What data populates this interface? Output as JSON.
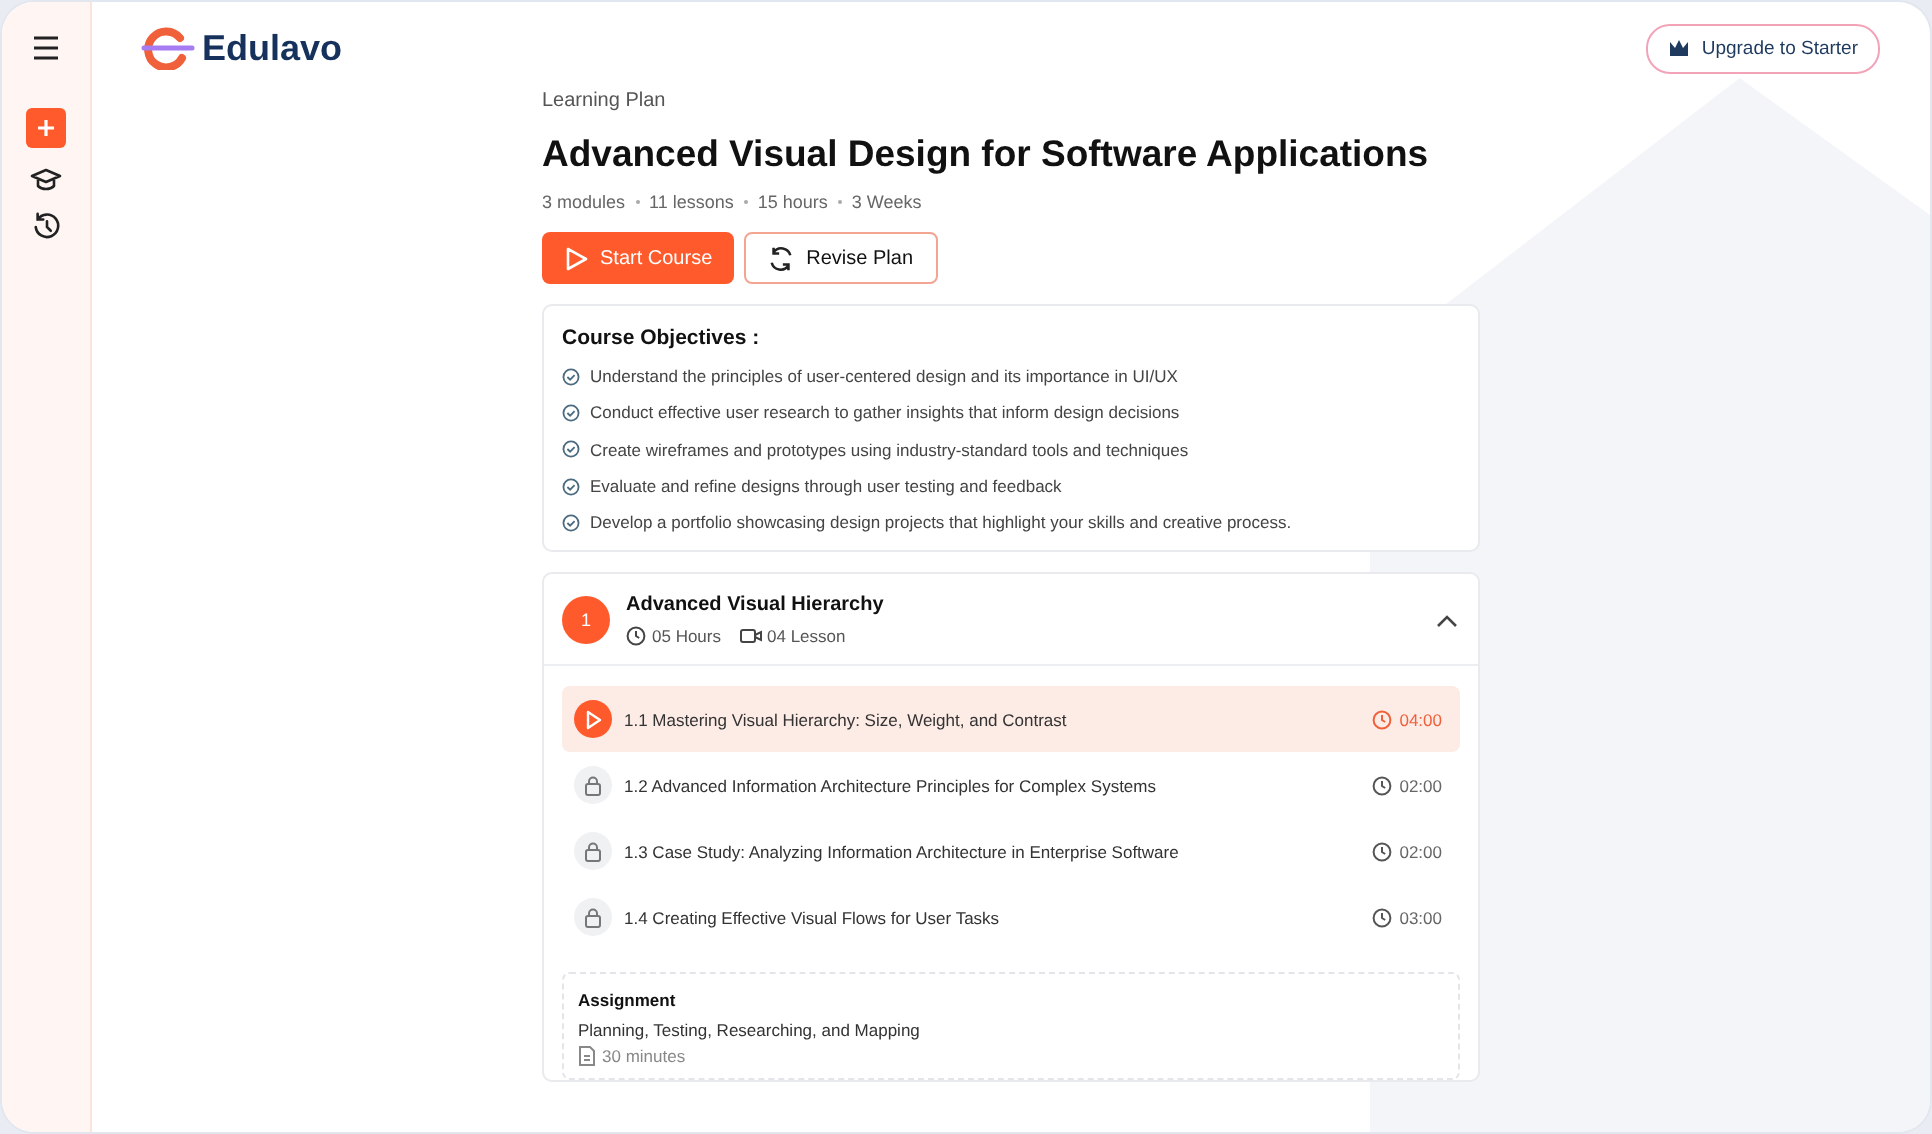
{
  "brand": {
    "name": "Edulavo"
  },
  "upgrade_button": {
    "label": "Upgrade to Starter"
  },
  "eyebrow": "Learning Plan",
  "title": "Advanced Visual Design for Software Applications",
  "meta": [
    "3 modules",
    "11 lessons",
    "15 hours",
    "3 Weeks"
  ],
  "actions": [
    {
      "label": "Start Course",
      "kind": "primary"
    },
    {
      "label": "Revise Plan",
      "kind": "secondary"
    }
  ],
  "objectives": {
    "heading": "Course Objectives :",
    "items": [
      "Understand the principles of user-centered design and its importance in UI/UX",
      "Conduct effective user research to gather insights that inform design decisions",
      "Create wireframes and prototypes using industry-standard tools and techniques",
      "Evaluate and refine designs through user testing and feedback",
      "Develop a portfolio showcasing design projects that highlight your skills and creative process."
    ]
  },
  "module": {
    "number": "1",
    "title": "Advanced Visual Hierarchy",
    "hours": "05 Hours",
    "lessons_count": "04 Lesson",
    "expanded": true,
    "lessons": [
      {
        "title": "1.1 Mastering Visual Hierarchy: Size, Weight, and Contrast",
        "duration": "04:00",
        "selected": true,
        "locked": false
      },
      {
        "title": "1.2 Advanced Information Architecture Principles for Complex Systems",
        "duration": "02:00",
        "selected": false,
        "locked": true
      },
      {
        "title": "1.3 Case Study: Analyzing Information Architecture in Enterprise Software",
        "duration": "02:00",
        "selected": false,
        "locked": true
      },
      {
        "title": "1.4 Creating Effective Visual Flows for User Tasks",
        "duration": "03:00",
        "selected": false,
        "locked": true
      }
    ],
    "assignment": {
      "heading": "Assignment",
      "text": "Planning, Testing, Researching, and Mapping",
      "duration": "30 minutes"
    }
  }
}
